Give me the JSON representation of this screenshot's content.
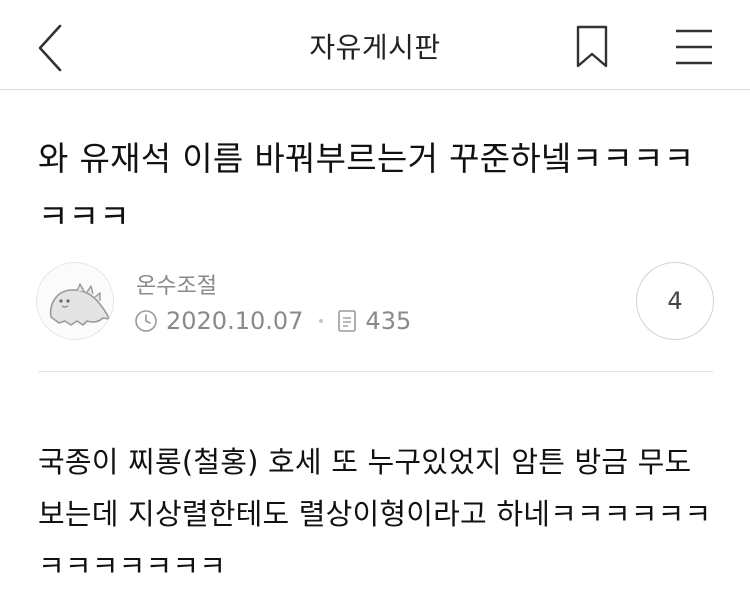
{
  "header": {
    "title": "자유게시판",
    "back_icon": "chevron-left-icon",
    "bookmark_icon": "bookmark-icon",
    "menu_icon": "hamburger-menu-icon"
  },
  "post": {
    "title": "와 유재석 이름 바꿔부르는거 꾸준하넼ㅋㅋㅋㅋㅋㅋㅋ",
    "author": "온수조절",
    "date": "2020.10.07",
    "views": "435",
    "comment_count": "4",
    "body": "국종이 찌롱(철홍) 호세 또 누구있었지 암튼 방금 무도 보는데 지상렬한테도 렬상이형이라고 하네ㅋㅋㅋㅋㅋㅋㅋㅋㅋㅋㅋㅋㅋ"
  },
  "colors": {
    "text_primary": "#111111",
    "text_meta": "#8a8a8a",
    "divider": "#e2e2e2"
  }
}
